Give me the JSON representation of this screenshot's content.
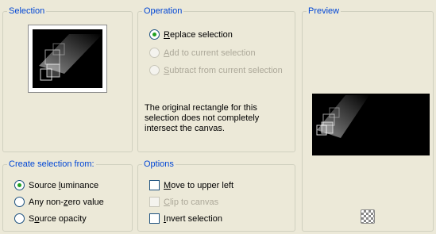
{
  "selection_group": {
    "title": "Selection"
  },
  "operation_group": {
    "title": "Operation",
    "options": [
      {
        "pre": "",
        "key": "R",
        "post": "eplace selection",
        "checked": true,
        "disabled": false
      },
      {
        "pre": "",
        "key": "A",
        "post": "dd to current selection",
        "checked": false,
        "disabled": true
      },
      {
        "pre": "",
        "key": "S",
        "post": "ubtract from current selection",
        "checked": false,
        "disabled": true
      }
    ],
    "message": "The original rectangle for this selection does not completely intersect the canvas."
  },
  "preview_group": {
    "title": "Preview",
    "transparency_button_icon": "checkerboard-icon"
  },
  "create_from_group": {
    "title": "Create selection from:",
    "options": [
      {
        "pre": "Source ",
        "key": "l",
        "post": "uminance",
        "checked": true
      },
      {
        "pre": "Any non-",
        "key": "z",
        "post": "ero value",
        "checked": false
      },
      {
        "pre": "S",
        "key": "o",
        "post": "urce opacity",
        "checked": false
      }
    ]
  },
  "options_group": {
    "title": "Options",
    "items": [
      {
        "pre": "",
        "key": "M",
        "post": "ove to upper left",
        "checked": false,
        "disabled": false
      },
      {
        "pre": "",
        "key": "C",
        "post": "lip to canvas",
        "checked": false,
        "disabled": true
      },
      {
        "pre": "",
        "key": "I",
        "post": "nvert selection",
        "checked": false,
        "disabled": false
      }
    ]
  }
}
